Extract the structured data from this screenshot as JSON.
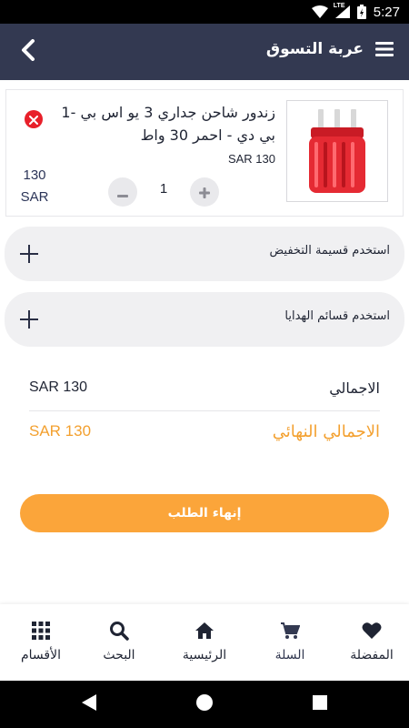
{
  "status": {
    "time": "5:27",
    "network": "LTE"
  },
  "header": {
    "title": "عربة التسوق"
  },
  "cart_item": {
    "name": "زندور شاحن جداري 3 يو اس بي -1 بي دي - احمر 30 واط",
    "price": "SAR 130",
    "quantity": "1",
    "line_total_value": "130",
    "line_total_currency": "SAR"
  },
  "coupon": {
    "label": "استخدم قسيمة التخفيض"
  },
  "gift": {
    "label": "استخدم قسائم الهدايا"
  },
  "summary": {
    "total_label": "الاجمالي",
    "total_value": "SAR 130",
    "final_label": "الاجمالي النهائي",
    "final_value": "SAR 130"
  },
  "checkout": {
    "label": "إنهاء الطلب"
  },
  "nav": {
    "favorites": "المفضلة",
    "cart": "السلة",
    "home": "الرئيسية",
    "search": "البحث",
    "categories": "الأقسام"
  },
  "colors": {
    "app_bar": "#333951",
    "accent_orange": "#fba53a",
    "remove_red": "#e8202a",
    "row_bg": "#f0f0f2"
  },
  "icons": {
    "back": "chevron-left-icon",
    "menu": "hamburger-menu-icon",
    "remove": "close-circle-icon",
    "add": "plus-icon",
    "favorites": "heart-icon",
    "cart": "cart-icon",
    "home": "home-icon",
    "search": "search-icon",
    "categories": "grid-icon"
  }
}
